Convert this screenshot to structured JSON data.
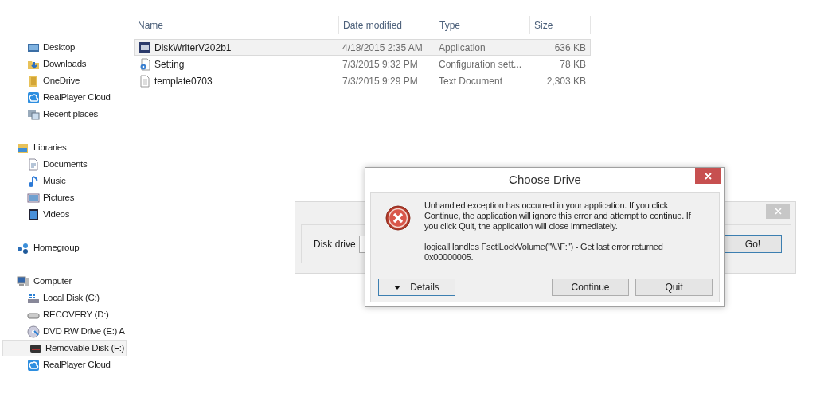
{
  "sidebar": {
    "groups": [
      {
        "items": [
          {
            "label": "Desktop",
            "selected": false
          },
          {
            "label": "Downloads",
            "selected": false
          },
          {
            "label": "OneDrive",
            "selected": false
          },
          {
            "label": "RealPlayer Cloud",
            "selected": false
          },
          {
            "label": "Recent places",
            "selected": false
          }
        ]
      },
      {
        "label": "Libraries",
        "items": [
          {
            "label": "Documents",
            "selected": false
          },
          {
            "label": "Music",
            "selected": false
          },
          {
            "label": "Pictures",
            "selected": false
          },
          {
            "label": "Videos",
            "selected": false
          }
        ]
      },
      {
        "label": "Homegroup"
      },
      {
        "label": "Computer",
        "items": [
          {
            "label": "Local Disk (C:)",
            "selected": false
          },
          {
            "label": "RECOVERY (D:)",
            "selected": false
          },
          {
            "label": "DVD RW Drive (E:) A",
            "selected": false
          },
          {
            "label": "Removable Disk (F:)",
            "selected": true
          },
          {
            "label": "RealPlayer Cloud",
            "selected": false
          }
        ]
      }
    ]
  },
  "file_list": {
    "columns": [
      "Name",
      "Date modified",
      "Type",
      "Size"
    ],
    "rows": [
      {
        "name": "DiskWriterV202b1",
        "date": "4/18/2015 2:35 AM",
        "type": "Application",
        "size": "636 KB",
        "selected": true
      },
      {
        "name": "Setting",
        "date": "7/3/2015 9:32 PM",
        "type": "Configuration sett...",
        "size": "78 KB",
        "selected": false
      },
      {
        "name": "template0703",
        "date": "7/3/2015 9:29 PM",
        "type": "Text Document",
        "size": "2,303 KB",
        "selected": false
      }
    ]
  },
  "background_window": {
    "drive_label": "Disk drive",
    "go_button": "Go!"
  },
  "dialog": {
    "title": "Choose Drive",
    "message": "Unhandled exception has occurred in your application. If you click Continue, the application will ignore this error and attempt to continue. If you click Quit, the application will close immediately.",
    "detail": "logicalHandles FsctlLockVolume(\"\\\\.\\F:\") - Get last error returned 0x00000005.",
    "buttons": [
      {
        "label": "Details",
        "kind": "details"
      },
      {
        "label": "Continue",
        "kind": "plain"
      },
      {
        "label": "Quit",
        "kind": "plain"
      }
    ]
  }
}
